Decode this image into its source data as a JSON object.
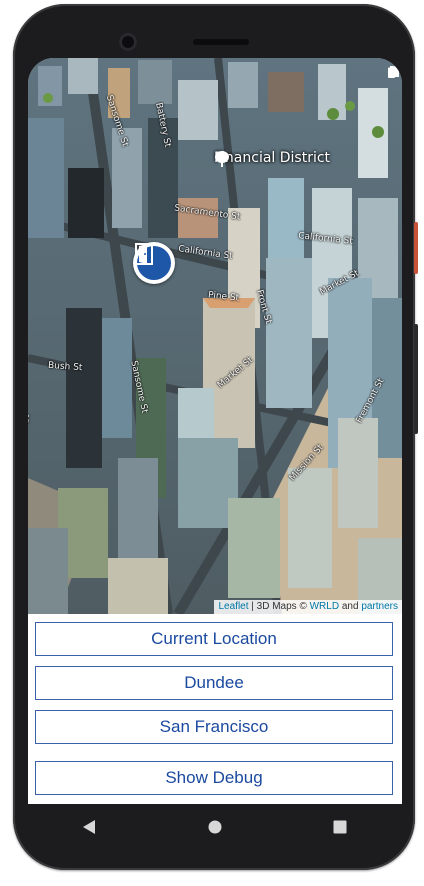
{
  "map": {
    "district_label": "Financial District",
    "district_icon": "tree-icon",
    "marker_icon": "door-exit-icon",
    "streets": {
      "sansome_top": "Sansome St",
      "battery": "Battery St",
      "sacramento": "Sacramento St",
      "california_1": "California St",
      "california_2": "California St",
      "pine": "Pine St",
      "front": "Front St",
      "market_1": "Market St",
      "market_2": "Market St",
      "bush": "Bush St",
      "sansome_bottom": "Sansome St",
      "st_left": "St",
      "mission": "Mission St",
      "fremont": "Fremont St"
    },
    "attribution": {
      "leaflet": "Leaflet",
      "sep1": " | 3D Maps © ",
      "wrld": "WRLD",
      "and": " and ",
      "partners": "partners"
    }
  },
  "status_bar": {
    "icons": [
      "wifi-icon",
      "cellular-icon",
      "battery-icon"
    ]
  },
  "buttons": {
    "current_location": "Current Location",
    "dundee": "Dundee",
    "san_francisco": "San Francisco",
    "show_debug": "Show Debug"
  },
  "navigation": {
    "icons": [
      "back-icon",
      "home-icon",
      "recents-icon"
    ]
  },
  "colors": {
    "button_border": "#3b61a8",
    "button_text": "#1b4aa0",
    "marker_blue": "#1e56a8"
  }
}
